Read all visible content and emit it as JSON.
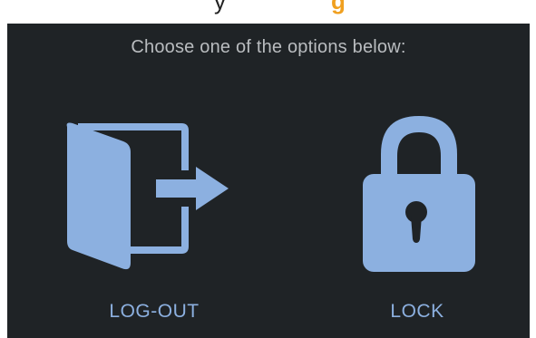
{
  "heading_fragment": {
    "before": "y",
    "accent": "g"
  },
  "dialog": {
    "prompt": "Choose one of the options below:",
    "options": [
      {
        "label": "LOG-OUT",
        "icon": "logout-door-icon"
      },
      {
        "label": "LOCK",
        "icon": "padlock-icon"
      }
    ]
  },
  "colors": {
    "dialog_bg": "#1f2326",
    "prompt_text": "#b9bcbf",
    "icon": "#8cb0e0",
    "label": "#8cb0e0",
    "accent": "#f0a020"
  }
}
